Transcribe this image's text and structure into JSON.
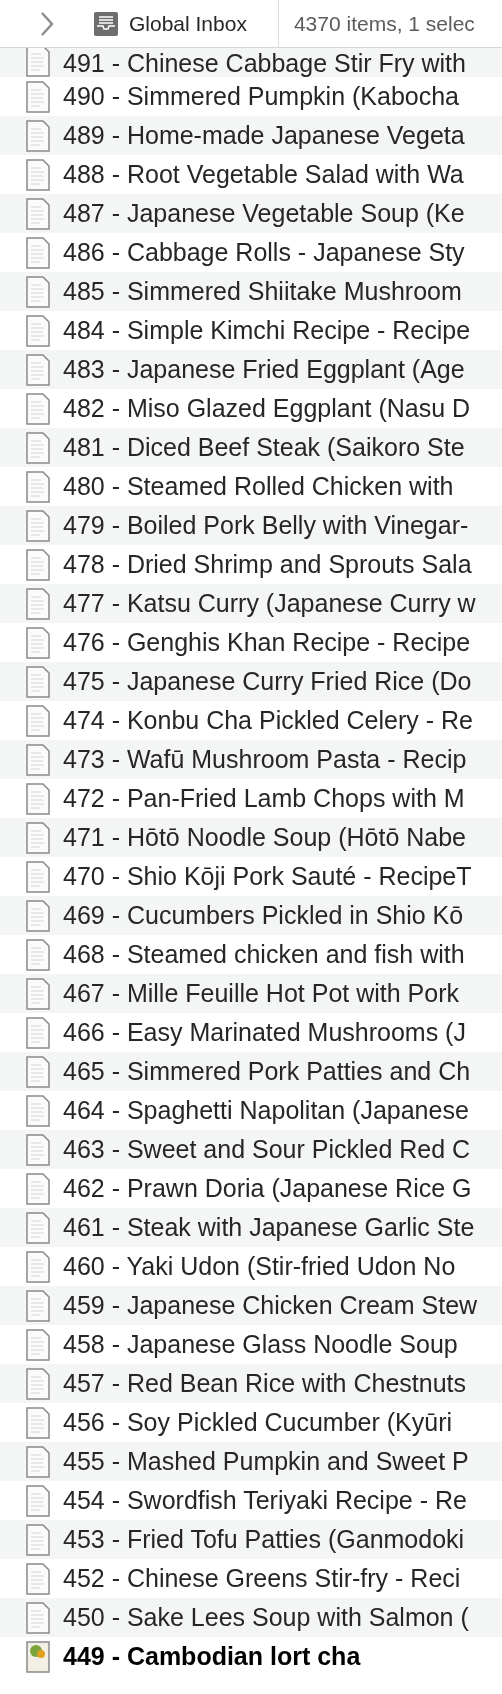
{
  "header": {
    "title": "Global Inbox",
    "status": "4370 items, 1 selec"
  },
  "items": [
    {
      "title": "491 - Chinese Cabbage Stir Fry with",
      "kind": "document",
      "unread": false
    },
    {
      "title": "490 - Simmered Pumpkin (Kabocha",
      "kind": "document",
      "unread": false
    },
    {
      "title": "489 - Home-made Japanese Vegeta",
      "kind": "document",
      "unread": false
    },
    {
      "title": "488 - Root Vegetable Salad with Wa",
      "kind": "document",
      "unread": false
    },
    {
      "title": "487 - Japanese Vegetable Soup (Ke",
      "kind": "document",
      "unread": false
    },
    {
      "title": "486 - Cabbage Rolls - Japanese Sty",
      "kind": "document",
      "unread": false
    },
    {
      "title": "485 - Simmered Shiitake Mushroom",
      "kind": "document",
      "unread": false
    },
    {
      "title": "484 - Simple Kimchi Recipe - Recipe",
      "kind": "document",
      "unread": false
    },
    {
      "title": "483 - Japanese Fried Eggplant (Age",
      "kind": "document",
      "unread": false
    },
    {
      "title": "482 - Miso Glazed Eggplant (Nasu D",
      "kind": "document",
      "unread": false
    },
    {
      "title": "481 - Diced Beef Steak (Saikoro Ste",
      "kind": "document",
      "unread": false
    },
    {
      "title": "480 - Steamed Rolled Chicken with",
      "kind": "document",
      "unread": false
    },
    {
      "title": "479 - Boiled Pork Belly with Vinegar-",
      "kind": "document",
      "unread": false
    },
    {
      "title": "478 - Dried Shrimp and Sprouts Sala",
      "kind": "document",
      "unread": false
    },
    {
      "title": "477 - Katsu Curry (Japanese Curry w",
      "kind": "document",
      "unread": false
    },
    {
      "title": "476 - Genghis Khan Recipe - Recipe",
      "kind": "document",
      "unread": false
    },
    {
      "title": "475 - Japanese Curry Fried Rice (Do",
      "kind": "document",
      "unread": false
    },
    {
      "title": "474 - Konbu Cha Pickled Celery - Re",
      "kind": "document",
      "unread": false
    },
    {
      "title": "473 - Wafū Mushroom Pasta - Recip",
      "kind": "document",
      "unread": false
    },
    {
      "title": "472 - Pan-Fried Lamb Chops with M",
      "kind": "document",
      "unread": false
    },
    {
      "title": "471 - Hōtō Noodle Soup (Hōtō Nabe",
      "kind": "document",
      "unread": false
    },
    {
      "title": "470 - Shio Kōji Pork Sauté - RecipeT",
      "kind": "document",
      "unread": false
    },
    {
      "title": "469 - Cucumbers Pickled in Shio Kō",
      "kind": "document",
      "unread": false
    },
    {
      "title": "468 - Steamed chicken and fish with",
      "kind": "document",
      "unread": false
    },
    {
      "title": "467 - Mille Feuille Hot Pot with Pork",
      "kind": "document",
      "unread": false
    },
    {
      "title": "466 - Easy Marinated Mushrooms (J",
      "kind": "document",
      "unread": false
    },
    {
      "title": "465 - Simmered Pork Patties and Ch",
      "kind": "document",
      "unread": false
    },
    {
      "title": "464 - Spaghetti Napolitan (Japanese",
      "kind": "document",
      "unread": false
    },
    {
      "title": "463 - Sweet and Sour Pickled Red C",
      "kind": "document",
      "unread": false
    },
    {
      "title": "462 - Prawn Doria (Japanese Rice G",
      "kind": "document",
      "unread": false
    },
    {
      "title": "461 - Steak with Japanese Garlic Ste",
      "kind": "document",
      "unread": false
    },
    {
      "title": "460 - Yaki Udon (Stir-fried Udon No",
      "kind": "document",
      "unread": false
    },
    {
      "title": "459 - Japanese Chicken Cream Stew",
      "kind": "document",
      "unread": false
    },
    {
      "title": "458 - Japanese Glass Noodle Soup",
      "kind": "document",
      "unread": false
    },
    {
      "title": "457 - Red Bean Rice with Chestnuts",
      "kind": "document",
      "unread": false
    },
    {
      "title": "456 - Soy Pickled Cucumber (Kyūri",
      "kind": "document",
      "unread": false
    },
    {
      "title": "455 - Mashed Pumpkin and Sweet P",
      "kind": "document",
      "unread": false
    },
    {
      "title": "454 - Swordfish Teriyaki Recipe - Re",
      "kind": "document",
      "unread": false
    },
    {
      "title": "453 - Fried Tofu Patties (Ganmodoki",
      "kind": "document",
      "unread": false
    },
    {
      "title": "452 - Chinese Greens Stir-fry - Reci",
      "kind": "document",
      "unread": false
    },
    {
      "title": "450 - Sake Lees Soup with Salmon (",
      "kind": "document",
      "unread": false
    },
    {
      "title": "449 - Cambodian lort cha",
      "kind": "image",
      "unread": true
    }
  ]
}
